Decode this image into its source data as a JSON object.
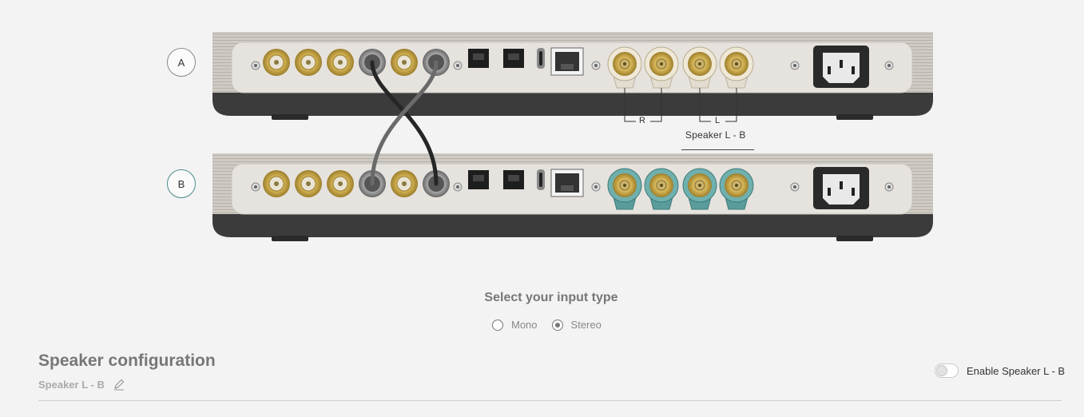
{
  "units": [
    {
      "id": "A"
    },
    {
      "id": "B"
    }
  ],
  "speaker_output": {
    "left_label": "L",
    "right_label": "R",
    "name": "Speaker L - B"
  },
  "input_type": {
    "title": "Select your input type",
    "options": [
      {
        "label": "Mono",
        "selected": false
      },
      {
        "label": "Stereo",
        "selected": true
      }
    ]
  },
  "speaker_configuration": {
    "title": "Speaker configuration",
    "name": "Speaker L - B",
    "enable_toggle": {
      "label": "Enable Speaker L - B",
      "enabled": false
    }
  },
  "colors": {
    "background": "#f3f3f3",
    "teal_accent": "#5a9c9c",
    "gold_connector": "#c9a94a"
  }
}
